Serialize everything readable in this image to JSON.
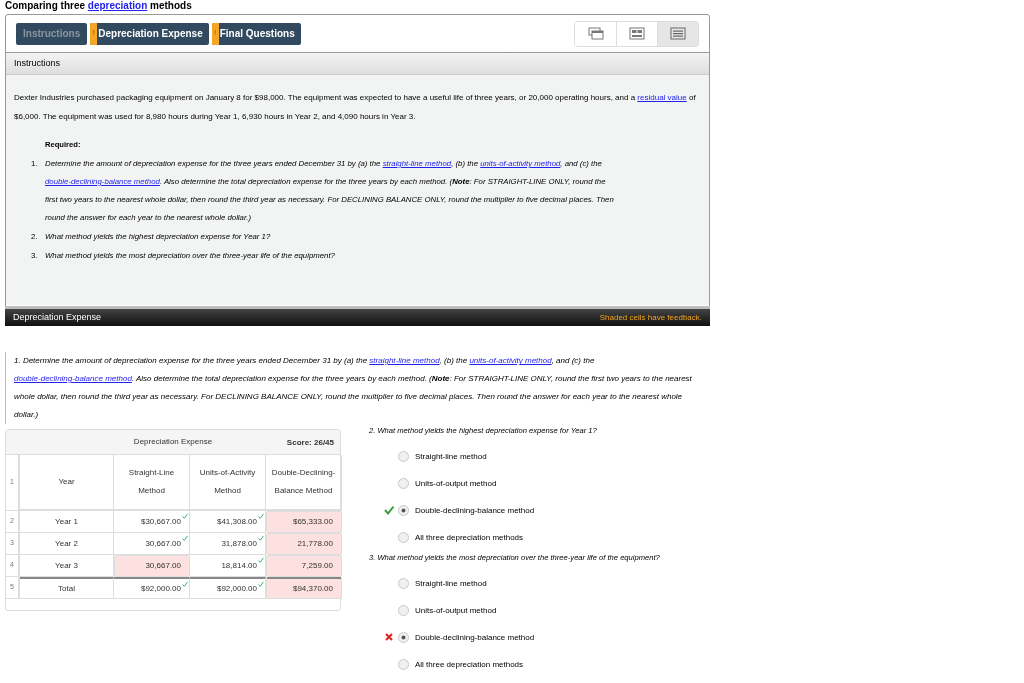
{
  "title": [
    {
      "kind": "text",
      "text": "Comparing three "
    },
    {
      "kind": "link",
      "text": "depreciation"
    },
    {
      "kind": "text",
      "text": " methods"
    }
  ],
  "tabs": [
    {
      "label": "Instructions",
      "selected": true
    },
    {
      "label": "Depreciation Expense",
      "selected": false,
      "flag": "!"
    },
    {
      "label": "Final Questions",
      "selected": false,
      "flag": "!"
    }
  ],
  "view_buttons": [
    {
      "kind": "windows",
      "selected": false
    },
    {
      "kind": "split",
      "selected": false
    },
    {
      "kind": "lines",
      "selected": true
    }
  ],
  "instructions": {
    "header": "Instructions",
    "intro": [
      {
        "kind": "text",
        "text": "Dexter Industries purchased packaging equipment on January 8 for $98,000. The equipment was expected to have a useful life of three years, or 20,000 operating hours, and a "
      },
      {
        "kind": "link",
        "text": "residual value"
      },
      {
        "kind": "text",
        "text": " of $6,000. The equipment was used for 8,980 hours during Year 1, 6,930 hours in Year 2, and 4,090 hours in Year 3."
      }
    ],
    "required_label": "Required:",
    "items": [
      {
        "number": "1.",
        "segments": [
          {
            "kind": "text",
            "text": "Determine the amount of depreciation expense for the three years ended December 31 by (a) the "
          },
          {
            "kind": "link",
            "text": "straight-line method"
          },
          {
            "kind": "text",
            "text": ", (b) the "
          },
          {
            "kind": "link",
            "text": "units-of-activity method"
          },
          {
            "kind": "text",
            "text": ", and (c) the "
          },
          {
            "kind": "link",
            "text": "double-declining-balance method"
          },
          {
            "kind": "text",
            "text": ". Also determine the total depreciation expense for the three years by each method. (**Note**: For STRAIGHT-LINE ONLY, round the first two years to the nearest whole dollar, then round the third year as necessary. For DECLINING BALANCE ONLY, round the multiplier to five decimal places. Then round the answer for each year to the nearest whole dollar.)"
          }
        ]
      },
      {
        "number": "2.",
        "segments": [
          {
            "kind": "text",
            "text": "What method yields the highest depreciation expense for Year 1?"
          }
        ]
      },
      {
        "number": "3.",
        "segments": [
          {
            "kind": "text",
            "text": "What method yields the most depreciation over the three-year life of the equipment?"
          }
        ]
      }
    ]
  },
  "section": {
    "header": "Depreciation Expense",
    "feedback_note": "Shaded cells have feedback.",
    "question": [
      {
        "kind": "text",
        "text": "1. Determine the amount of depreciation expense for the three years ended December 31 by (a) the "
      },
      {
        "kind": "link",
        "text": "straight-line method"
      },
      {
        "kind": "text",
        "text": ", (b) the "
      },
      {
        "kind": "link",
        "text": "units-of-activity method"
      },
      {
        "kind": "text",
        "text": ", and (c) the "
      },
      {
        "kind": "link",
        "text": "double-declining-balance method"
      },
      {
        "kind": "text",
        "text": ". Also determine the total depreciation expense for the three years by each method. (**Note**: For STRAIGHT-LINE ONLY, round the first two years to the nearest whole dollar, then round the third year as necessary. For DECLINING BALANCE ONLY, round the multiplier to five decimal places. Then round the answer for each year to the nearest whole dollar.)"
      }
    ]
  },
  "table": {
    "title": "Depreciation Expense",
    "score": "Score: 26/45",
    "header": {
      "row_number": "1",
      "cells": [
        "Year",
        "Straight-Line Method",
        "Units-of-Activity Method",
        "Double-Declining-Balance Method"
      ]
    },
    "rows": [
      {
        "row_number": "2",
        "year": "Year 1",
        "cells": [
          {
            "value": "$30,667.00",
            "correct": true,
            "shaded": false
          },
          {
            "value": "$41,308.00",
            "correct": true,
            "shaded": false
          },
          {
            "value": "$65,333.00",
            "correct": false,
            "shaded": true
          }
        ]
      },
      {
        "row_number": "3",
        "year": "Year 2",
        "cells": [
          {
            "value": "30,667.00",
            "correct": true,
            "shaded": false
          },
          {
            "value": "31,878.00",
            "correct": true,
            "shaded": false
          },
          {
            "value": "21,778.00",
            "correct": false,
            "shaded": true
          }
        ]
      },
      {
        "row_number": "4",
        "year": "Year 3",
        "cells": [
          {
            "value": "30,667.00",
            "correct": false,
            "shaded": true
          },
          {
            "value": "18,814.00",
            "correct": true,
            "shaded": false
          },
          {
            "value": "7,259.00",
            "correct": false,
            "shaded": true
          }
        ]
      },
      {
        "row_number": "5",
        "year": "Total",
        "cells": [
          {
            "value": "$92,000.00",
            "correct": true,
            "shaded": false
          },
          {
            "value": "$92,000.00",
            "correct": true,
            "shaded": false
          },
          {
            "value": "$94,370.00",
            "correct": false,
            "shaded": true
          }
        ]
      }
    ]
  },
  "questions": [
    {
      "prompt": "2. What method yields the highest depreciation expense for Year 1?",
      "options": [
        {
          "label": "Straight-line method",
          "selected": false
        },
        {
          "label": "Units-of-output method",
          "selected": false
        },
        {
          "label": "Double-declining-balance method",
          "selected": true,
          "correct": true
        },
        {
          "label": "All three depreciation methods",
          "selected": false
        }
      ]
    },
    {
      "prompt": "3. What method yields the most depreciation over the three-year life of the equipment?",
      "options": [
        {
          "label": "Straight-line method",
          "selected": false
        },
        {
          "label": "Units-of-output method",
          "selected": false
        },
        {
          "label": "Double-declining-balance method",
          "selected": true,
          "correct": false
        },
        {
          "label": "All three depreciation methods",
          "selected": false
        }
      ]
    }
  ]
}
